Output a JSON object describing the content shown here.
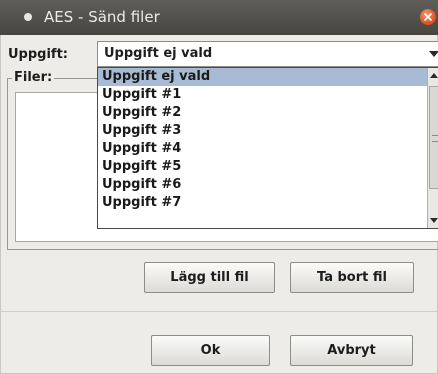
{
  "window": {
    "title": "AES - Sänd filer"
  },
  "form": {
    "task_label": "Uppgift:",
    "task_selected": "Uppgift ej vald",
    "files_label": "Filer:"
  },
  "dropdown": {
    "options": [
      "Uppgift ej vald",
      "Uppgift #1",
      "Uppgift #2",
      "Uppgift #3",
      "Uppgift #4",
      "Uppgift #5",
      "Uppgift #6",
      "Uppgift #7"
    ],
    "highlighted_index": 0
  },
  "buttons": {
    "add_file": "Lägg till fil",
    "remove_file": "Ta bort fil",
    "ok": "Ok",
    "cancel": "Avbryt"
  },
  "colors": {
    "highlight": "#a9bbd4",
    "close_button": "#e2552a",
    "titlebar": "#4f4e48"
  }
}
